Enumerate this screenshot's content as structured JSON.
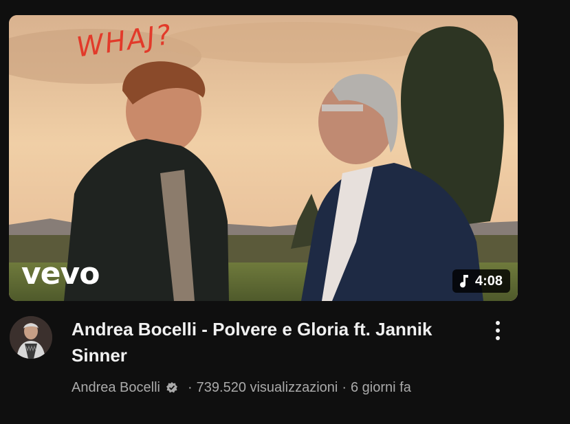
{
  "video": {
    "title": "Andrea Bocelli - Polvere e Gloria ft. Jannik Sinner",
    "duration": "4:08",
    "duration_icon": "music-note-icon",
    "thumbnail_logo": "vevo",
    "thumbnail_annotation": "WHAJ?",
    "channel": "Andrea Bocelli",
    "verified_icon": "verified-badge-icon",
    "separator": "·",
    "views": "739.520 visualizzazioni",
    "age": "6 giorni fa",
    "menu_icon": "more-vert-icon"
  },
  "colors": {
    "background": "#0f0f0f",
    "title": "#f1f1f1",
    "meta": "#aaaaaa",
    "annotation": "#e23a2a"
  }
}
